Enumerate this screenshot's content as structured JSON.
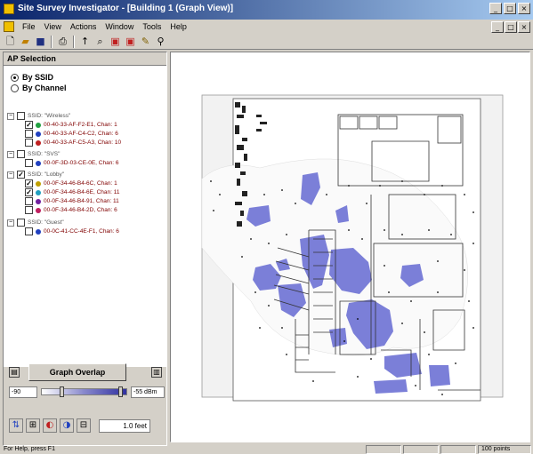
{
  "window": {
    "title": "Site Survey Investigator - [Building 1 (Graph View)]"
  },
  "menu": [
    "File",
    "View",
    "Actions",
    "Window",
    "Tools",
    "Help"
  ],
  "toolbar": {
    "icons": [
      "new-icon",
      "open-icon",
      "save-icon",
      "print-icon",
      "arrow-icon",
      "zoom-icon",
      "grid-icon",
      "map-icon",
      "pencil-icon",
      "pointer-icon"
    ]
  },
  "left_panel": {
    "header": "AP Selection",
    "radio_ssid": "By SSID",
    "radio_channel": "By Channel",
    "groups": [
      {
        "ssid": "SSID: \"Wireless\"",
        "aps": [
          {
            "label": "00-40-33-AF-F2-E1, Chan: 1",
            "color": "#20a040",
            "checked": true
          },
          {
            "label": "00-40-33-AF-C4-C2, Chan: 6",
            "color": "#2040c0",
            "checked": false
          },
          {
            "label": "00-40-33-AF-C5-A3, Chan: 10",
            "color": "#c02020",
            "checked": false
          }
        ]
      },
      {
        "ssid": "SSID: \"SVS\"",
        "aps": [
          {
            "label": "00-0F-3D-03-CE-0E, Chan: 6",
            "color": "#2040c0",
            "checked": false
          }
        ]
      },
      {
        "ssid": "SSID: \"Lobby\"",
        "aps": [
          {
            "label": "00-0F-34-46-B4-6C, Chan: 1",
            "color": "#c0a000",
            "checked": true
          },
          {
            "label": "00-0F-34-46-B4-6E, Chan: 11",
            "color": "#20a0c0",
            "checked": true
          },
          {
            "label": "00-0F-34-46-B4-91, Chan: 11",
            "color": "#7020a0",
            "checked": false
          },
          {
            "label": "00-0F-34-46-B4-2D, Chan: 6",
            "color": "#c02060",
            "checked": false
          }
        ]
      },
      {
        "ssid": "SSID: \"Guest\"",
        "aps": [
          {
            "label": "00-0C-41-CC-4E-F1, Chan: 6",
            "color": "#2040c0",
            "checked": false
          }
        ]
      }
    ],
    "graph_button": "Graph Overlap",
    "range_low": "-90",
    "range_high": "-55 dBm",
    "feet_value": "1.0 feet"
  },
  "status": {
    "left": "For Help, press F1",
    "right": "100 points"
  },
  "colors": {
    "coverage": "#7b7fd8",
    "titlebar_start": "#0a246a"
  }
}
